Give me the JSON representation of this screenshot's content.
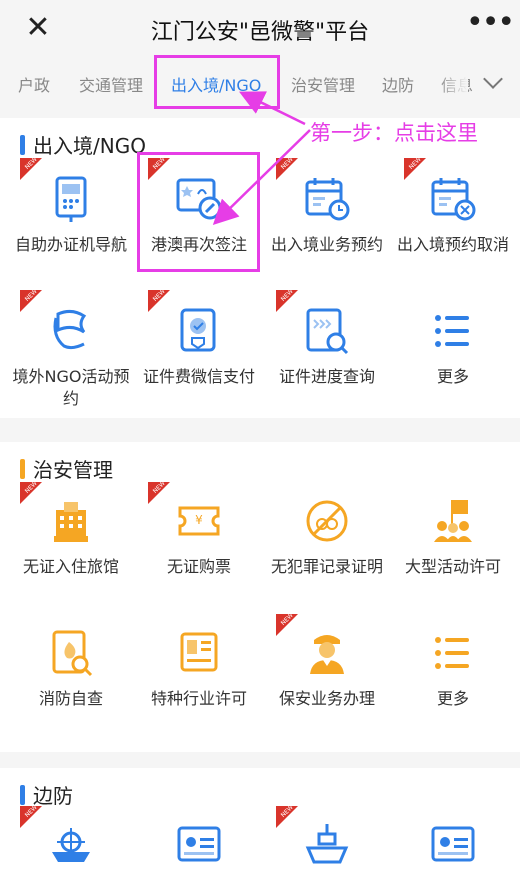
{
  "header": {
    "close_icon": "close-icon",
    "title": "江门公安\"邑微警\"平台",
    "more_icon": "more-dots-icon"
  },
  "tabs": [
    {
      "label": "户政",
      "active": false
    },
    {
      "label": "交通管理",
      "active": false
    },
    {
      "label": "出入境/NGO",
      "active": true
    },
    {
      "label": "治安管理",
      "active": false
    },
    {
      "label": "边防",
      "active": false
    },
    {
      "label": "信息",
      "active": false
    }
  ],
  "callout": "第一步：点击这里",
  "sections": [
    {
      "title": "出入境/NGO",
      "color": "#2f7fe6",
      "items": [
        {
          "label": "自助办证机导航",
          "icon": "kiosk-icon",
          "new": true
        },
        {
          "label": "港澳再次签注",
          "icon": "passport-endorse-icon",
          "new": true
        },
        {
          "label": "出入境业务预约",
          "icon": "calendar-clock-icon",
          "new": true
        },
        {
          "label": "出入境预约取消",
          "icon": "calendar-cancel-icon",
          "new": true
        },
        {
          "label": "境外NGO活动预约",
          "icon": "flag-icon",
          "new": true
        },
        {
          "label": "证件费微信支付",
          "icon": "wechat-pay-icon",
          "new": true
        },
        {
          "label": "证件进度查询",
          "icon": "progress-search-icon",
          "new": true
        },
        {
          "label": "更多",
          "icon": "list-icon",
          "new": false
        }
      ]
    },
    {
      "title": "治安管理",
      "color": "#f5a623",
      "items": [
        {
          "label": "无证入住旅馆",
          "icon": "hotel-icon",
          "new": true
        },
        {
          "label": "无证购票",
          "icon": "ticket-icon",
          "new": true
        },
        {
          "label": "无犯罪记录证明",
          "icon": "no-handcuffs-icon",
          "new": false
        },
        {
          "label": "大型活动许可",
          "icon": "crowd-flag-icon",
          "new": false
        },
        {
          "label": "消防自查",
          "icon": "fire-check-icon",
          "new": false
        },
        {
          "label": "特种行业许可",
          "icon": "license-icon",
          "new": false
        },
        {
          "label": "保安业务办理",
          "icon": "security-guard-icon",
          "new": true
        },
        {
          "label": "更多",
          "icon": "list-icon",
          "new": false
        }
      ]
    },
    {
      "title": "边防",
      "color": "#2f7fe6",
      "items": [
        {
          "label": "",
          "icon": "ship-wheel-icon",
          "new": true
        },
        {
          "label": "",
          "icon": "id-card-icon",
          "new": false
        },
        {
          "label": "",
          "icon": "ship-icon",
          "new": true
        },
        {
          "label": "",
          "icon": "id-card-2-icon",
          "new": false
        }
      ]
    }
  ],
  "badge_text": "NEW"
}
